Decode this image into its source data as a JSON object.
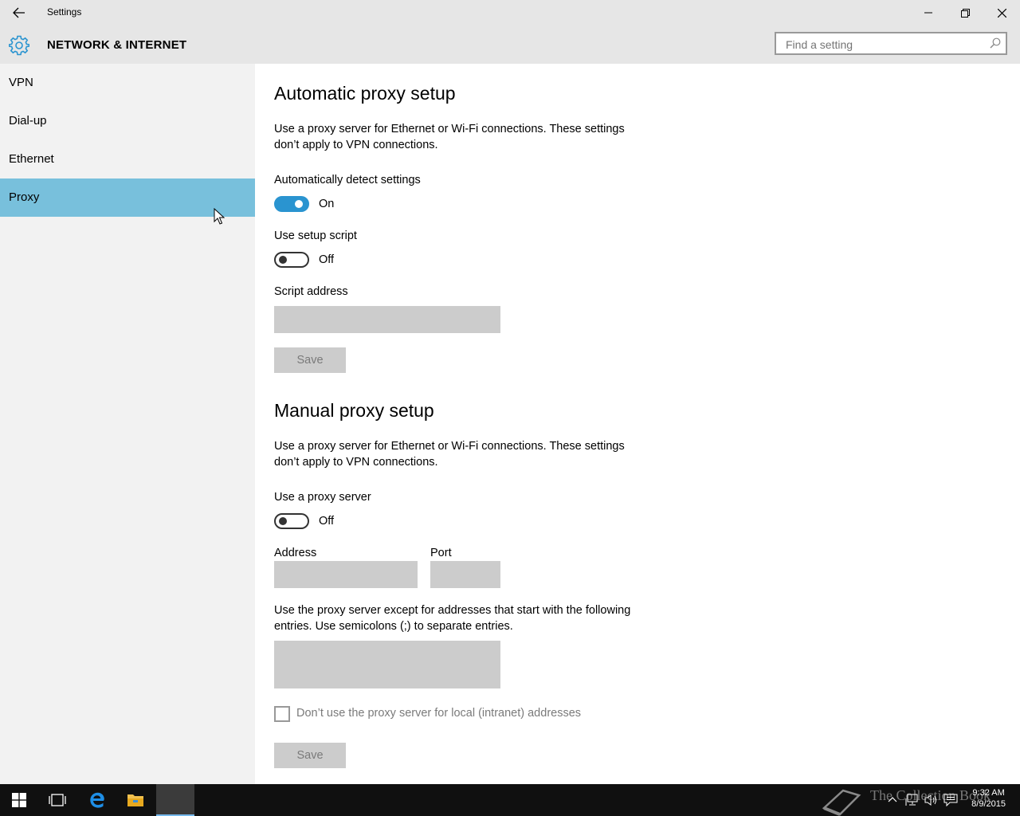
{
  "window": {
    "title": "Settings",
    "back_icon": "back-arrow-icon",
    "minimize_icon": "minimize-icon",
    "restore_icon": "restore-icon",
    "close_icon": "close-icon"
  },
  "header": {
    "title": "NETWORK & INTERNET",
    "search_placeholder": "Find a setting",
    "accent": "#2a94d0"
  },
  "sidebar": {
    "items": [
      {
        "label": "VPN",
        "active": false
      },
      {
        "label": "Dial-up",
        "active": false
      },
      {
        "label": "Ethernet",
        "active": false
      },
      {
        "label": "Proxy",
        "active": true
      }
    ],
    "active_color": "#78c0dc"
  },
  "automatic": {
    "heading": "Automatic proxy setup",
    "description": "Use a proxy server for Ethernet or Wi-Fi connections. These settings don’t apply to VPN connections.",
    "detect_label": "Automatically detect settings",
    "detect_state": "On",
    "script_label": "Use setup script",
    "script_state": "Off",
    "address_label": "Script address",
    "save_label": "Save"
  },
  "manual": {
    "heading": "Manual proxy setup",
    "description": "Use a proxy server for Ethernet or Wi-Fi connections. These settings don’t apply to VPN connections.",
    "use_label": "Use a proxy server",
    "use_state": "Off",
    "address_label": "Address",
    "port_label": "Port",
    "exceptions_description": "Use the proxy server except for addresses that start with the following entries. Use semicolons (;) to separate entries.",
    "local_checkbox_label": "Don’t use the proxy server for local (intranet) addresses",
    "save_label": "Save"
  },
  "taskbar": {
    "time": "9:32 AM",
    "date": "8/9/2015",
    "watermark": "The Collection Book"
  }
}
